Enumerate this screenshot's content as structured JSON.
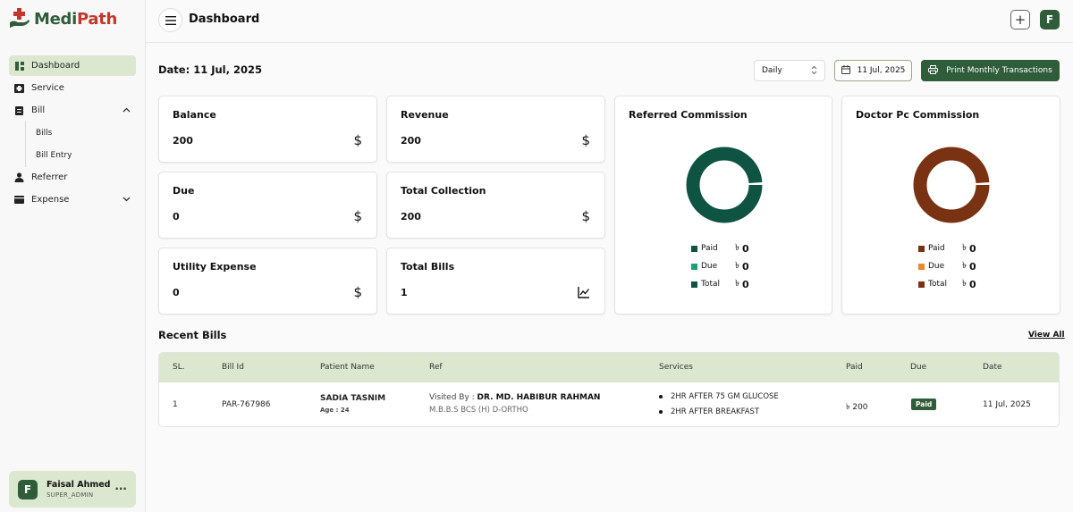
{
  "app": {
    "logo_text_a": "Medi",
    "logo_text_b": "Path",
    "brand_green": "#2f5d3a",
    "brand_red": "#c0392b"
  },
  "sidebar": {
    "items": [
      {
        "label": "Dashboard",
        "icon": "dashboard-icon",
        "active": true
      },
      {
        "label": "Service",
        "icon": "service-icon"
      },
      {
        "label": "Bill",
        "icon": "bill-icon",
        "expanded": true
      },
      {
        "label": "Bills",
        "sub": true
      },
      {
        "label": "Bill Entry",
        "sub": true
      },
      {
        "label": "Referrer",
        "icon": "referrer-icon"
      },
      {
        "label": "Expense",
        "icon": "expense-icon",
        "collapsed": true
      }
    ]
  },
  "user": {
    "initial": "F",
    "name": "Faisal Ahmed",
    "role": "SUPER_ADMIN"
  },
  "header": {
    "title": "Dashboard",
    "add_label": "+",
    "avatar_initial": "F"
  },
  "toolbar": {
    "date_label": "Date: 11 Jul, 2025",
    "period": "Daily",
    "date_value": "11 Jul, 2025",
    "print_label": "Print Monthly Transactions"
  },
  "stats": {
    "balance": {
      "title": "Balance",
      "value": "200",
      "icon": "$"
    },
    "due": {
      "title": "Due",
      "value": "0",
      "icon": "$"
    },
    "utility": {
      "title": "Utility Expense",
      "value": "0",
      "icon": "$"
    },
    "revenue": {
      "title": "Revenue",
      "value": "200",
      "icon": "$"
    },
    "collection": {
      "title": "Total Collection",
      "value": "200",
      "icon": "$"
    },
    "bills": {
      "title": "Total Bills",
      "value": "1",
      "icon": "chart-line-icon"
    }
  },
  "referred": {
    "title": "Referred Commission",
    "color": "#0f5443",
    "legend": [
      {
        "label": "Paid",
        "value": "0",
        "color": "#0f5443"
      },
      {
        "label": "Due",
        "value": "0",
        "color": "#19a27a"
      },
      {
        "label": "Total",
        "value": "0",
        "color": "#0f5443"
      }
    ]
  },
  "doctor": {
    "title": "Doctor Pc Commission",
    "color": "#7a3312",
    "legend": [
      {
        "label": "Paid",
        "value": "0",
        "color": "#7a3312"
      },
      {
        "label": "Due",
        "value": "0",
        "color": "#e8892a"
      },
      {
        "label": "Total",
        "value": "0",
        "color": "#7a3312"
      }
    ]
  },
  "currency": "৳",
  "recent": {
    "title": "Recent Bills",
    "view_all": "View All",
    "columns": {
      "sl": "SL.",
      "bill_id": "Bill Id",
      "patient": "Patient Name",
      "ref": "Ref",
      "services": "Services",
      "paid": "Paid",
      "due": "Due",
      "date": "Date"
    },
    "row": {
      "sl": "1",
      "bill_id": "PAR-767986",
      "patient_name": "SADIA TASNIM",
      "patient_age": "Age : 24",
      "ref_prefix": "Visited By : ",
      "ref_doctor": "DR. MD. HABIBUR RAHMAN",
      "ref_degree": "M.B.B.S BCS (H) D-ORTHO",
      "services": [
        "2HR AFTER 75 GM GLUCOSE",
        "2HR AFTER BREAKFAST"
      ],
      "paid": "৳ 200",
      "due": "Paid",
      "date": "11 Jul, 2025"
    }
  }
}
